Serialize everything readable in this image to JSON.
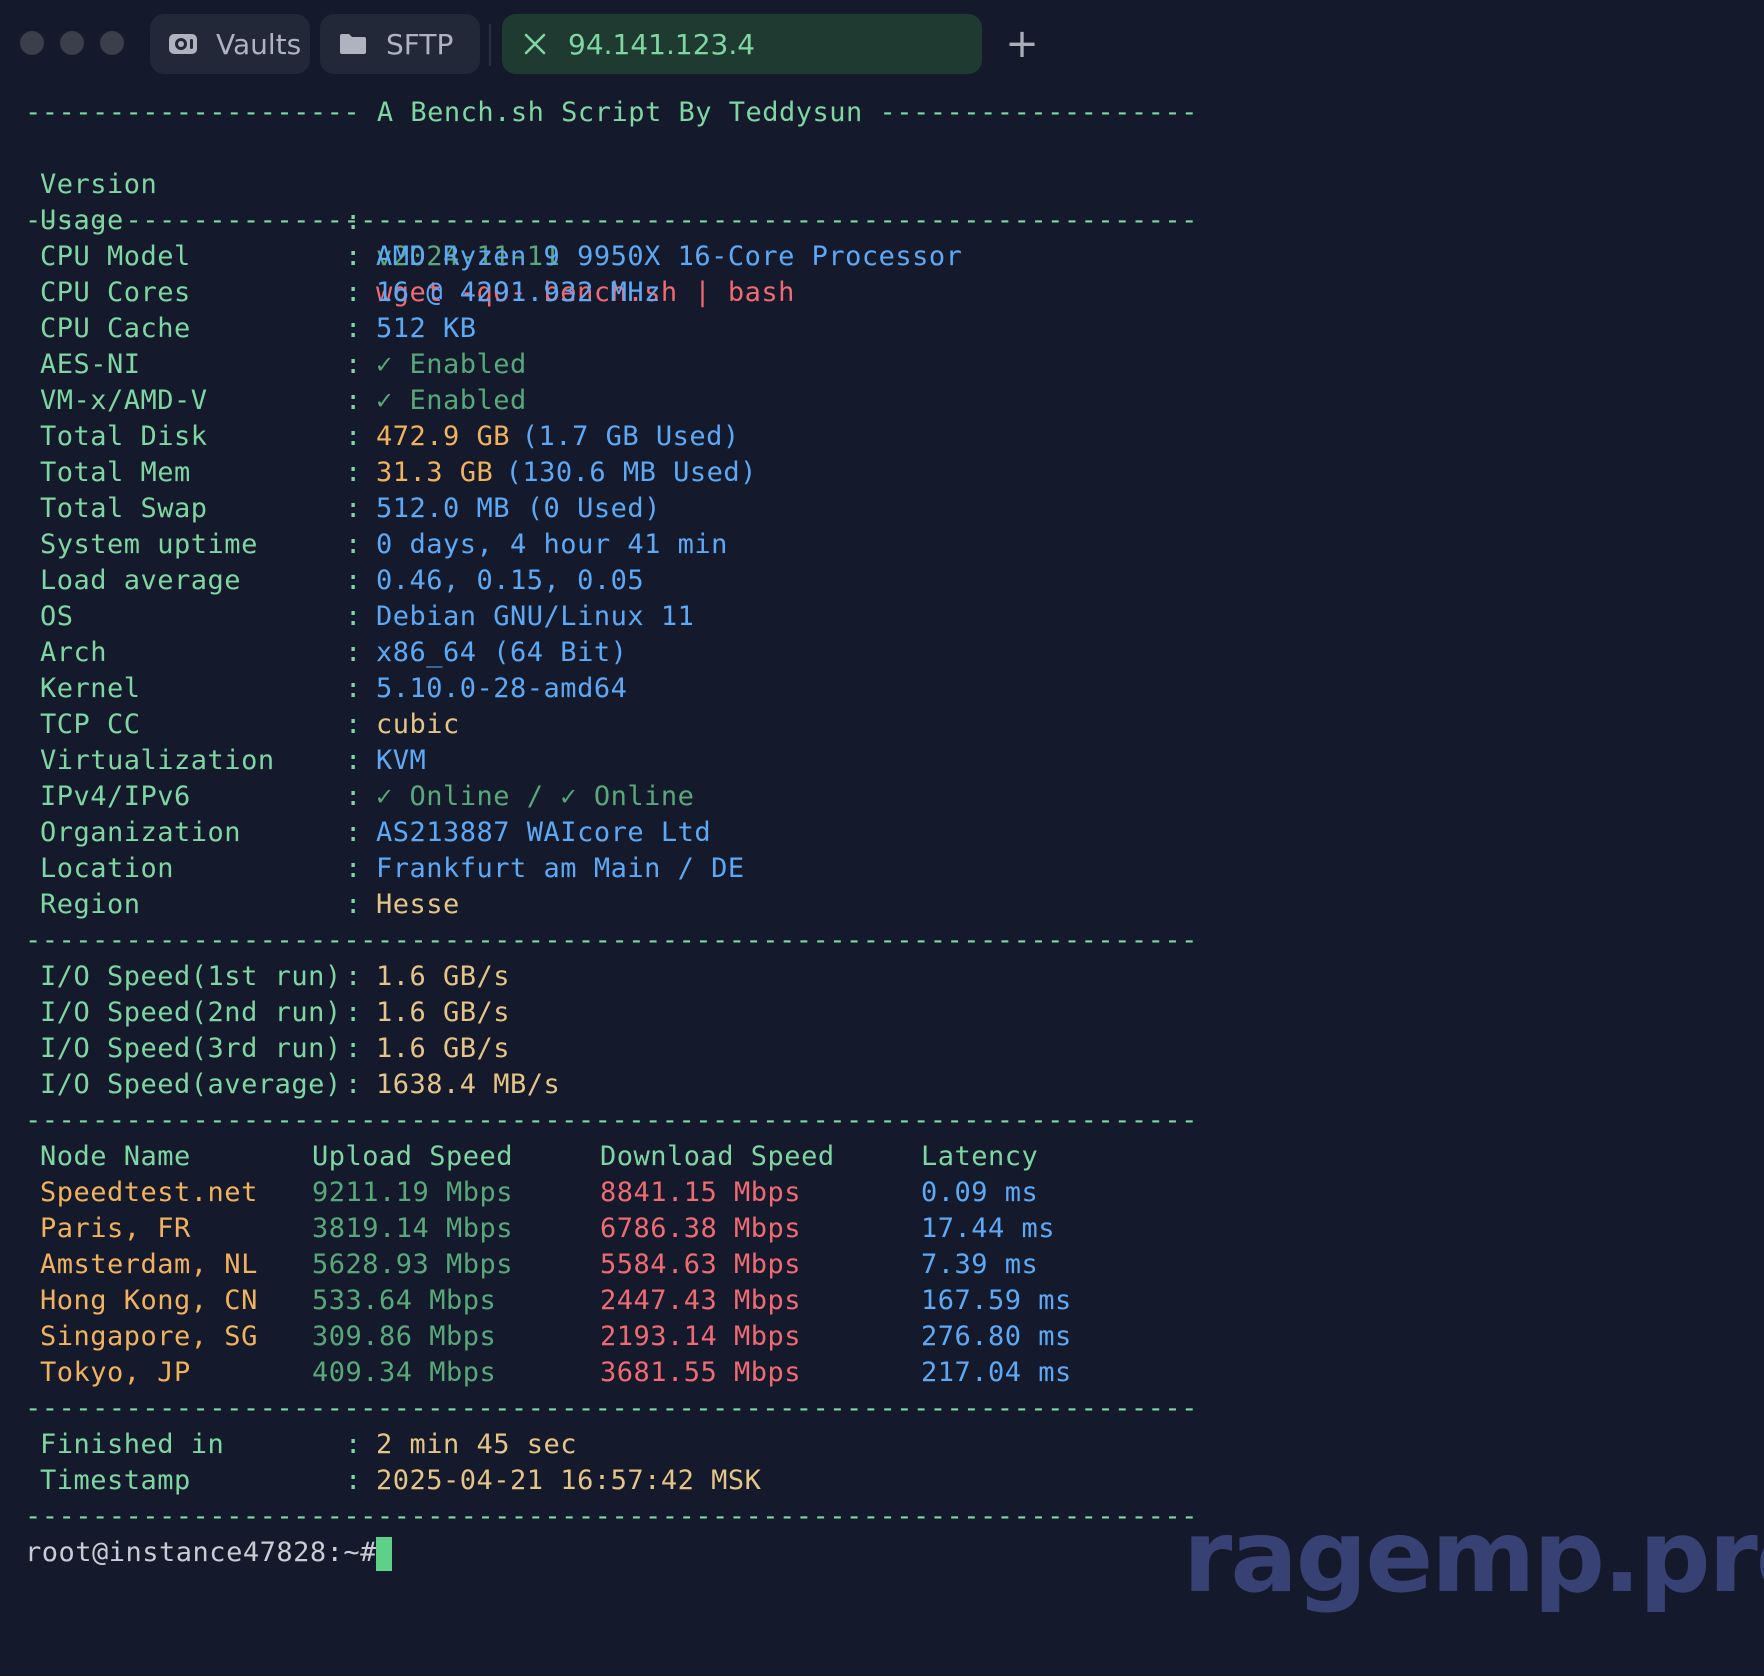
{
  "tabs": [
    {
      "label": "Vaults",
      "icon": "vault-icon"
    },
    {
      "label": "SFTP",
      "icon": "folder-icon"
    },
    {
      "label": "94.141.123.4",
      "icon": "close-icon",
      "active": true
    }
  ],
  "header": {
    "banner": "-------------------- A Bench.sh Script By Teddysun -------------------",
    "version_label": "Version",
    "version_value": "v2024-11-11",
    "usage_label": "Usage",
    "usage_value": "wget -qO- bench.sh | bash"
  },
  "divider": "----------------------------------------------------------------------",
  "sysinfo": [
    {
      "label": "CPU Model",
      "value": "AMD Ryzen 9 9950X 16-Core Processor",
      "color": "b"
    },
    {
      "label": "CPU Cores",
      "value": "16 @ 4291.932 MHz",
      "color": "b"
    },
    {
      "label": "CPU Cache",
      "value": "512 KB",
      "color": "b"
    },
    {
      "label": "AES-NI",
      "value": "✓ Enabled",
      "color": "gd"
    },
    {
      "label": "VM-x/AMD-V",
      "value": "✓ Enabled",
      "color": "gd"
    },
    {
      "label": "Total Disk",
      "value": "472.9 GB",
      "value2": "(1.7 GB Used)",
      "color": "o",
      "color2": "b"
    },
    {
      "label": "Total Mem",
      "value": "31.3 GB",
      "value2": "(130.6 MB Used)",
      "color": "o",
      "color2": "b"
    },
    {
      "label": "Total Swap",
      "value": "512.0 MB (0 Used)",
      "color": "b"
    },
    {
      "label": "System uptime",
      "value": "0 days, 4 hour 41 min",
      "color": "b"
    },
    {
      "label": "Load average",
      "value": "0.46, 0.15, 0.05",
      "color": "b"
    },
    {
      "label": "OS",
      "value": "Debian GNU/Linux 11",
      "color": "b"
    },
    {
      "label": "Arch",
      "value": "x86_64 (64 Bit)",
      "color": "b"
    },
    {
      "label": "Kernel",
      "value": "5.10.0-28-amd64",
      "color": "b"
    },
    {
      "label": "TCP CC",
      "value": "cubic",
      "color": "y"
    },
    {
      "label": "Virtualization",
      "value": "KVM",
      "color": "b"
    },
    {
      "label": "IPv4/IPv6",
      "value": "✓ Online / ✓ Online",
      "color": "gd"
    },
    {
      "label": "Organization",
      "value": "AS213887 WAIcore Ltd",
      "color": "b"
    },
    {
      "label": "Location",
      "value": "Frankfurt am Main / DE",
      "color": "b"
    },
    {
      "label": "Region",
      "value": "Hesse",
      "color": "y"
    }
  ],
  "io": [
    {
      "label": "I/O Speed(1st run)",
      "value": "1.6 GB/s"
    },
    {
      "label": "I/O Speed(2nd run)",
      "value": "1.6 GB/s"
    },
    {
      "label": "I/O Speed(3rd run)",
      "value": "1.6 GB/s"
    },
    {
      "label": "I/O Speed(average)",
      "value": "1638.4 MB/s"
    }
  ],
  "speedtest": {
    "headers": [
      "Node Name",
      "Upload Speed",
      "Download Speed",
      "Latency"
    ],
    "rows": [
      [
        "Speedtest.net",
        "9211.19 Mbps",
        "8841.15 Mbps",
        "0.09 ms"
      ],
      [
        "Paris, FR",
        "3819.14 Mbps",
        "6786.38 Mbps",
        "17.44 ms"
      ],
      [
        "Amsterdam, NL",
        "5628.93 Mbps",
        "5584.63 Mbps",
        "7.39 ms"
      ],
      [
        "Hong Kong, CN",
        "533.64 Mbps",
        "2447.43 Mbps",
        "167.59 ms"
      ],
      [
        "Singapore, SG",
        "309.86 Mbps",
        "2193.14 Mbps",
        "276.80 ms"
      ],
      [
        "Tokyo, JP",
        "409.34 Mbps",
        "3681.55 Mbps",
        "217.04 ms"
      ]
    ]
  },
  "footer": [
    {
      "label": "Finished in",
      "value": "2 min 45 sec"
    },
    {
      "label": "Timestamp",
      "value": "2025-04-21 16:57:42 MSK"
    }
  ],
  "prompt": "root@instance47828:~#",
  "watermark": "ragemp.pro",
  "colors": {
    "background": "#141a2b",
    "green": "#7fd6a2",
    "red": "#ee6b74",
    "blue": "#5ea9f5",
    "yellow": "#e5c487",
    "cursor": "#5fd088",
    "watermark": "#3a4477"
  }
}
